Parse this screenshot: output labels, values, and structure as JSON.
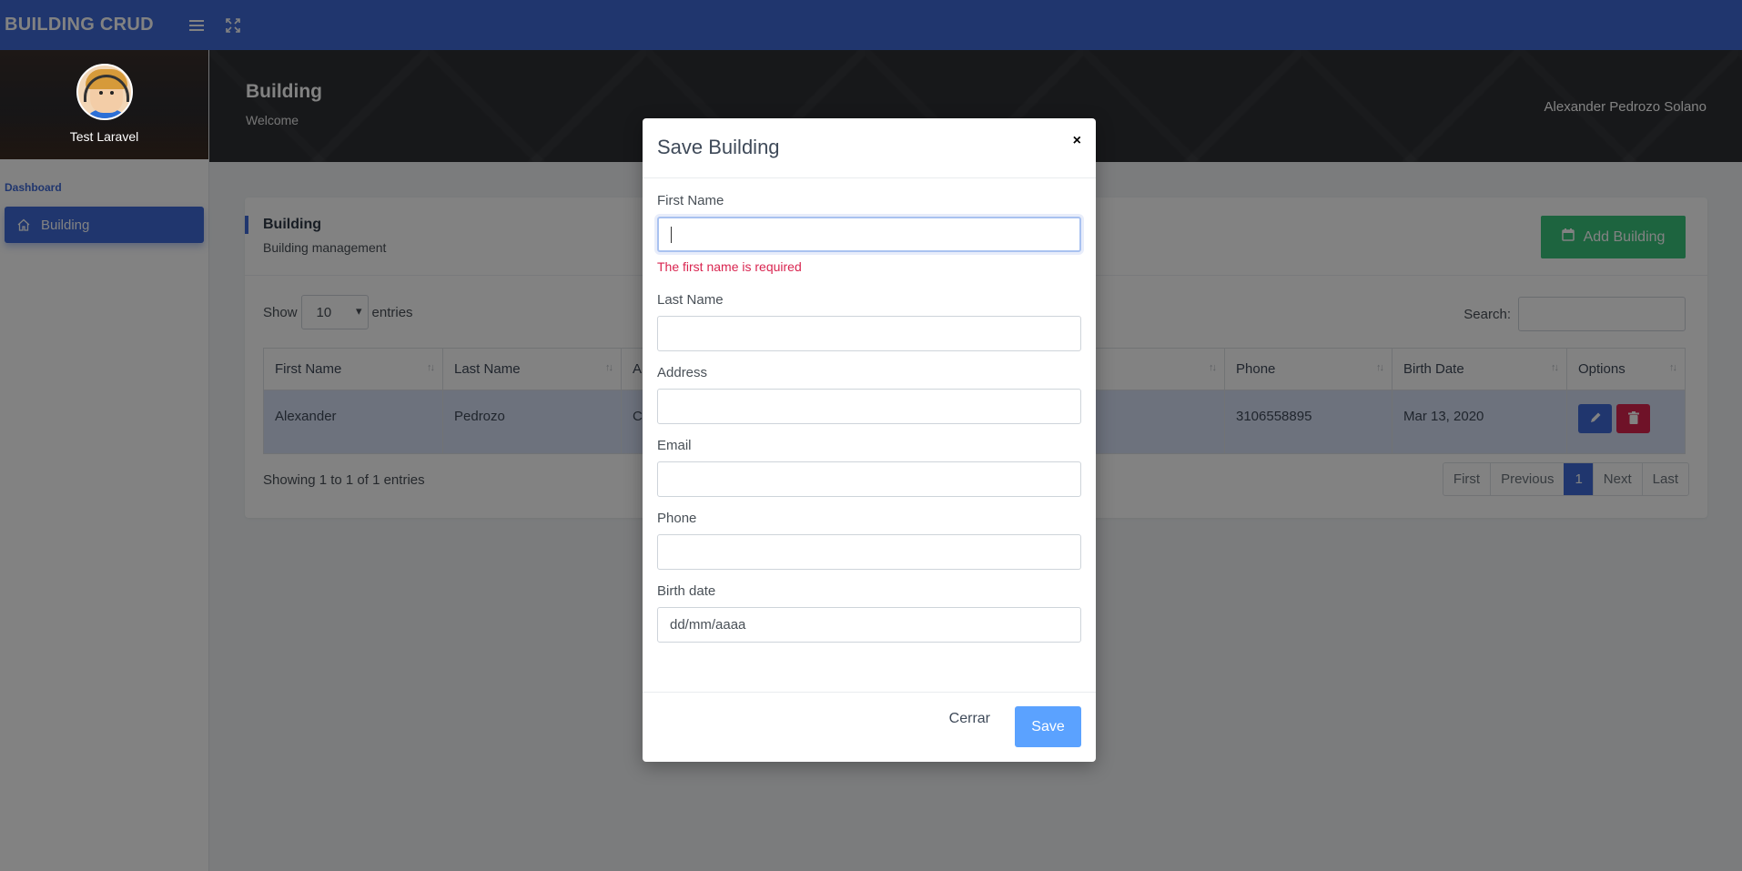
{
  "app": {
    "brand": "BUILDING CRUD"
  },
  "topbar": {
    "menu_icon": "hamburger-icon",
    "fullscreen_icon": "expand-icon"
  },
  "sidebar": {
    "profile_name": "Test Laravel",
    "heading": "Dashboard",
    "items": [
      {
        "label": "Building",
        "icon": "home-icon"
      }
    ]
  },
  "header": {
    "title": "Building",
    "subtitle": "Welcome",
    "user": "Alexander Pedrozo Solano"
  },
  "card": {
    "title": "Building",
    "subtitle": "Building management",
    "add_button": "Add Building",
    "show_label": "Show",
    "page_size": "10",
    "entries_label": "entries",
    "search_label": "Search:",
    "columns": [
      "First Name",
      "Last Name",
      "A",
      "",
      "Phone",
      "Birth Date",
      "Options"
    ],
    "rows": [
      {
        "first_name": "Alexander",
        "last_name": "Pedrozo",
        "address": "C",
        "email": "",
        "phone": "3106558895",
        "birth_date": "Mar 13, 2020"
      }
    ],
    "showing": "Showing 1 to 1 of 1 entries",
    "pager": [
      "First",
      "Previous",
      "1",
      "Next",
      "Last"
    ]
  },
  "modal": {
    "title": "Save Building",
    "close": "×",
    "fields": {
      "first_name": {
        "label": "First Name",
        "value": "",
        "error": "The first name is required"
      },
      "last_name": {
        "label": "Last Name",
        "value": ""
      },
      "address": {
        "label": "Address",
        "value": ""
      },
      "email": {
        "label": "Email",
        "value": ""
      },
      "phone": {
        "label": "Phone",
        "value": ""
      },
      "birth_date": {
        "label": "Birth date",
        "placeholder": "dd/mm/aaaa"
      }
    },
    "cancel": "Cerrar",
    "save": "Save"
  },
  "colors": {
    "primary": "#3f6ad8",
    "success": "#3ac47d",
    "danger": "#d92550",
    "save": "#5ba2ff"
  }
}
